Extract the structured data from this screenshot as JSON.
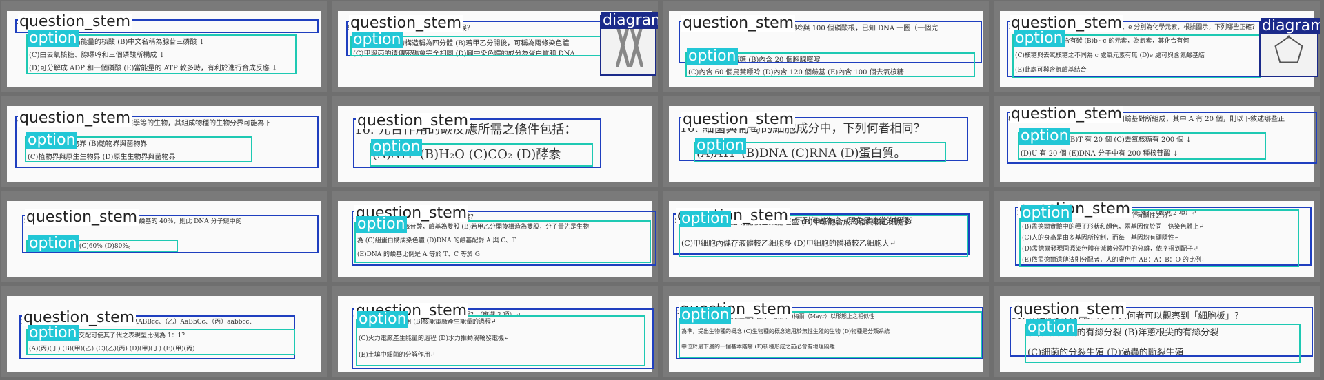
{
  "labels": {
    "stem": "question_stem",
    "option": "option",
    "diagram": "diagram"
  },
  "tiles": [
    {
      "q": "下列有關生物的敘述，哪些正確？ ↓",
      "opts": [
        "(A)是一種含有高能量的核酸 (B)中文名稱為腺苷三磷酸 ↓",
        "(C)由去氧核糖、腺嘌呤和三個磷酸所構成 ↓",
        "(D)可分解成 ADP 和一個磷酸 (E)當能量的 ATP 較多時，有利於進行合成反應 ↓"
      ],
      "diagram": false
    },
    {
      "q": "5. 下列關於細胞分裂的敘述，何者錯誤？",
      "opts": [
        "(A)此為聯會後的構造稱為四分體 (B)若甲乙分開後，可稱為兩條染色體",
        "(C)甲與丙的遺傳密碼會完全相同 (D)圖中染色體的成分為蛋白質和 DNA"
      ],
      "diagram": true
    },
    {
      "q": "10. 某雙股 DNA 分子具有 20 個腺嘌呤與 100 個磷酸根，已知 DNA 一圈（一個完",
      "opts": [
        "(A)內含 50 個核糖 (B)內含 20 個胸腺嘧啶",
        "(C)內含 60 個鳥糞嘌呤 (D)內含 120 個鹼基 (E)內含 100 個去氧核糖"
      ],
      "diagram": false
    },
    {
      "q": "10. 右圖為細胞內的構造圖，a、b、c、d、e 分別為化學元素，根據圖示，下列哪些正確？",
      "opts": [
        "(A)a~e 的元素中含有碳 (B)b~c 的元素，為氮素，其化合有何",
        "(C)核糖與去氧核糖之不同為 c 處氧元素有無 (D)e 處可與含氮鹼基結",
        "(E)此處可與含氮鹼基結合"
      ],
      "diagram": true
    },
    {
      "q": "18. 依生命界的分類系統中有完善生態學等的生物，其組成物種的生物分界可能為下",
      "opts": [
        "(A)動物界與植物界 (B)動物界與菌物界",
        "(C)植物界與原生生物界 (D)原生生物界與菌物界"
      ],
      "diagram": false
    },
    {
      "q": "16. 光合作用的碳反應所需之條件包括：",
      "opts": [
        "(A)ATP (B)H₂O (C)CO₂ (D)酵素"
      ],
      "diagram": false
    },
    {
      "q": "10. 細菌與葡萄的細胞成分中，下列何者相同？",
      "opts": [
        "(A)ATP (B)DNA (C)RNA (D)蛋白質。"
      ],
      "diagram": false
    },
    {
      "q": "8. 已知一分子雙股的 DNA 由 100 個鹼基對所組成，其中 A 有 20 個，則以下敘述哪些正",
      "opts": [
        "(A)C 有 30 個 (B)T 有 20 個 (C)去氧核糖有 200 個 ↓",
        "(D)U 有 20 個 (E)DNA 分子中有 200 種核苷酸 ↓"
      ],
      "diagram": false
    },
    {
      "q": "13. 某 DNA 分子中的 A 和 T 占所有含氮鹼基的 40%，則此 DNA 分子鏈中的",
      "opts": [
        "(A)30% (B)40% (C)60% (D)80%。"
      ],
      "diagram": false
    },
    {
      "q": "54. 下列有關於遺傳物質的敘述，哪些正確？",
      "opts": [
        "(A)雙股中的八種核苷酸，鹼基為雙股 (B)若甲乙分開後構造為雙股，分子量先是生物",
        "為 (C)組蛋白構成染色體 (D)DNA 的鹼基配對 A 與 C、T",
        "(E)DNA 的鹼基比例是 A 等於 T、C 等於 G"
      ],
      "diagram": false
    },
    {
      "q": "53. 生物的高基因組成較乙細胞多，下列何者為這一現象最適當的解釋？",
      "opts": [
        "(A)甲細胞的分泌功能較乙細胞旺盛 (B)甲細胞合成的脂質較乙細胞多",
        "(C)甲細胞內儲存液體較乙細胞多 (D)甲細胞的體積較乙細胞大↵"
      ],
      "diagram": false
    },
    {
      "q": "10. 下列有關孟德爾遺傳法則的推論，哪些正確？（應選 2 項）↵",
      "opts": [
        "(A)孟德爾的豌豆試驗中，發現乙遺傳因子有顯性之分↵",
        "(B)孟德爾實驗中的種子形狀和顏色，兩基因位於同一條染色體上↵",
        "(C)人的身高是由多基因所控制，而每一基因均有顯隱性↵",
        "(D)孟德爾發現同源染色體在減數分裂中的分離，依序得到配子↵",
        "(E)依孟德爾遺傳法則分配者，人的膚色中 AB：A：B：O 的比例↵"
      ],
      "diagram": false
    },
    {
      "q": "15. 有 4 個個體，其基因型分別是（甲）AABBcc、（乙）AaBbCc、（丙）aabbcc、",
      "opts": [
        "上述個體中哪兩者交配可使其子代之表現型比例為 1：1？",
        "(A)(丙)(丁) (B)(甲)(乙) (C)(乙)(丙) (D)(甲)(丁) (E)(甲)(丙)"
      ],
      "diagram": false
    },
    {
      "q": "53. 下列哪些事件與生態系的物質循環有關？（應選 3 項）↵",
      "opts": [
        "(A)植物的光合作用 (B)核能電廠產生能量的過程↵",
        "(C)火力電廠產生能量的過程 (D)水力推動渦輪發電機↵",
        "(E)土壤中細菌的分解作用↵"
      ],
      "diagram": false
    },
    {
      "q": "26. 下列有關生物分類的概念，何者正確？↵",
      "opts": [
        "(A)林奈建立了以屬名加上種小名的二名法 (B)梅爾（Mayr）以形態上之相似性",
        "為準，提出生物種的概念 (C)生物種的概念適用於無性生殖的生物 (D)物種是分類系統",
        "中位於最下層的一個基本階層 (E)新種形成之前必會有地理隔離"
      ],
      "diagram": false
    },
    {
      "q": "11. 在細胞進行分裂時，下列何者可以觀察到「細胞板」？",
      "opts": [
        "(A)白魚胚胎的有絲分裂 (B)洋蔥根尖的有絲分裂",
        "(C)細菌的分裂生殖 (D)渦蟲的斷裂生殖"
      ],
      "diagram": false
    }
  ]
}
